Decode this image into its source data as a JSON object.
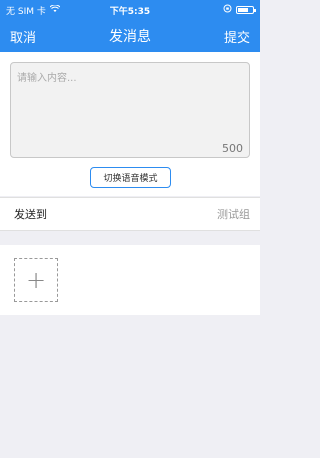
{
  "statusbar": {
    "carrier": "无 SIM 卡",
    "time": "下午5:35"
  },
  "navbar": {
    "cancel_label": "取消",
    "title": "发消息",
    "submit_label": "提交"
  },
  "compose": {
    "placeholder": "请输入内容...",
    "counter": "500",
    "voice_toggle_label": "切换语音模式"
  },
  "recipient": {
    "label": "发送到",
    "value": "测试组"
  },
  "attachments": {
    "add_icon_glyph": "+"
  }
}
